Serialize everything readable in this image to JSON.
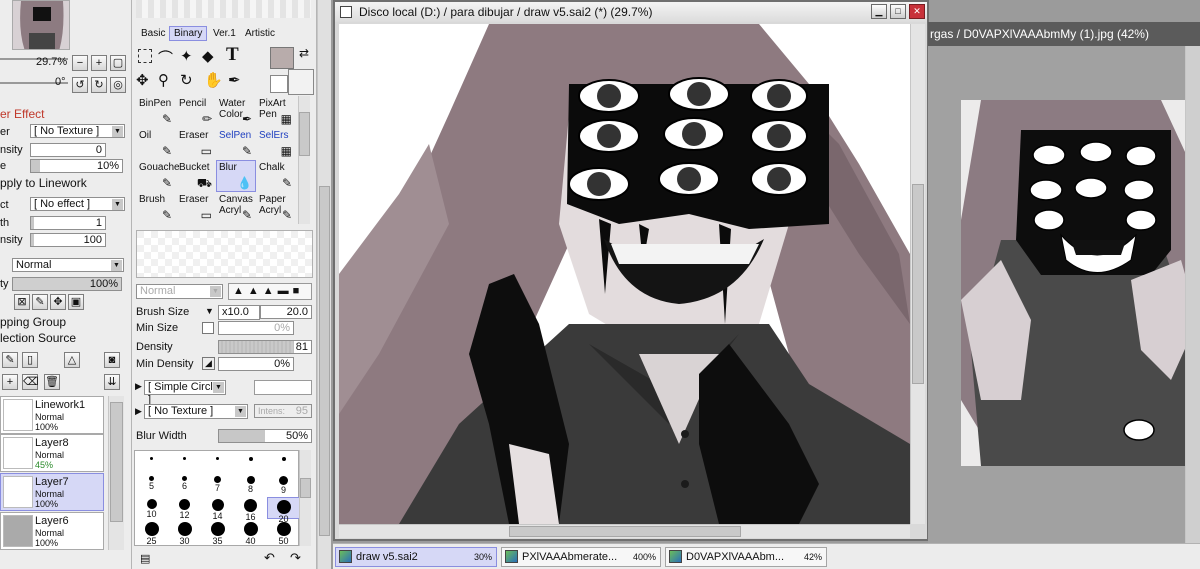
{
  "left_panel": {
    "zoom": "29.7%",
    "angle": "0°",
    "effect_header": "er Effect",
    "texture_label": "er",
    "texture_value": "[ No Texture ]",
    "density_label": "nsity",
    "density_value": "0",
    "size_label": "e",
    "size_value": "10%",
    "apply_linework": "pply to Linework",
    "effect_label": "ct",
    "effect_value": "[ No effect ]",
    "width_label": "th",
    "width_value": "1",
    "intensity_label": "nsity",
    "intensity_value": "100",
    "blend_mode": "Normal",
    "opacity_label": "ty",
    "opacity_value": "100%",
    "clipping_group": "pping Group",
    "selection_source": "lection Source",
    "layers": [
      {
        "name": "Linework1",
        "mode": "Normal",
        "opacity": "100%"
      },
      {
        "name": "Layer8",
        "mode": "Normal",
        "opacity": "45%"
      },
      {
        "name": "Layer7",
        "mode": "Normal",
        "opacity": "100%"
      },
      {
        "name": "Layer6",
        "mode": "Normal",
        "opacity": "100%"
      }
    ]
  },
  "tool_panel": {
    "tabs": [
      "Basic",
      "Binary",
      "Ver.1",
      "Artistic"
    ],
    "tools": [
      {
        "label": "BinPen"
      },
      {
        "label": "Pencil"
      },
      {
        "label": "Water Color"
      },
      {
        "label": "PixArt Pen"
      },
      {
        "label": "Oil"
      },
      {
        "label": "Eraser"
      },
      {
        "label": "SelPen"
      },
      {
        "label": "SelErs"
      },
      {
        "label": "Gouache"
      },
      {
        "label": "Bucket"
      },
      {
        "label": "Blur"
      },
      {
        "label": "Chalk"
      },
      {
        "label": "Brush"
      },
      {
        "label": "Eraser"
      },
      {
        "label": "Canvas Acryl"
      },
      {
        "label": "Paper Acryl"
      }
    ],
    "blend_select": "Normal",
    "brush_size_label": "Brush Size",
    "brush_size_mult": "x10.0",
    "brush_size_value": "20.0",
    "min_size_label": "Min Size",
    "min_size_value": "0%",
    "density_label": "Density",
    "density_value": "81",
    "min_density_label": "Min Density",
    "min_density_value": "0%",
    "shape_value": "[ Simple Circle ]",
    "texture_value": "[ No Texture ]",
    "intensity_label": "Intens:",
    "intensity_value": "95",
    "blur_width_label": "Blur Width",
    "blur_width_value": "50%",
    "blur_width_level": 0.5,
    "brush_sizes": [
      "",
      "",
      "",
      "",
      "",
      "5",
      "6",
      "7",
      "8",
      "9",
      "10",
      "12",
      "14",
      "16",
      "20",
      "25",
      "30",
      "35",
      "40",
      "50"
    ]
  },
  "main_window": {
    "title": "Disco local (D:) / para dibujar / draw v5.sai2 (*) (29.7%)"
  },
  "second_window": {
    "title": "rgas / D0VAPXlVAAAbmMy (1).jpg (42%)"
  },
  "taskbar": [
    {
      "name": "draw v5.sai2",
      "zoom": "30%"
    },
    {
      "name": "PXlVAAAbmerate...",
      "zoom": "400%"
    },
    {
      "name": "D0VAPXlVAAAbm...",
      "zoom": "42%"
    }
  ],
  "colors": {
    "accent": "#d6d8f6",
    "hair": "#8e7a80",
    "mask": "#0b0b0b",
    "close_button": "#c8313a"
  }
}
